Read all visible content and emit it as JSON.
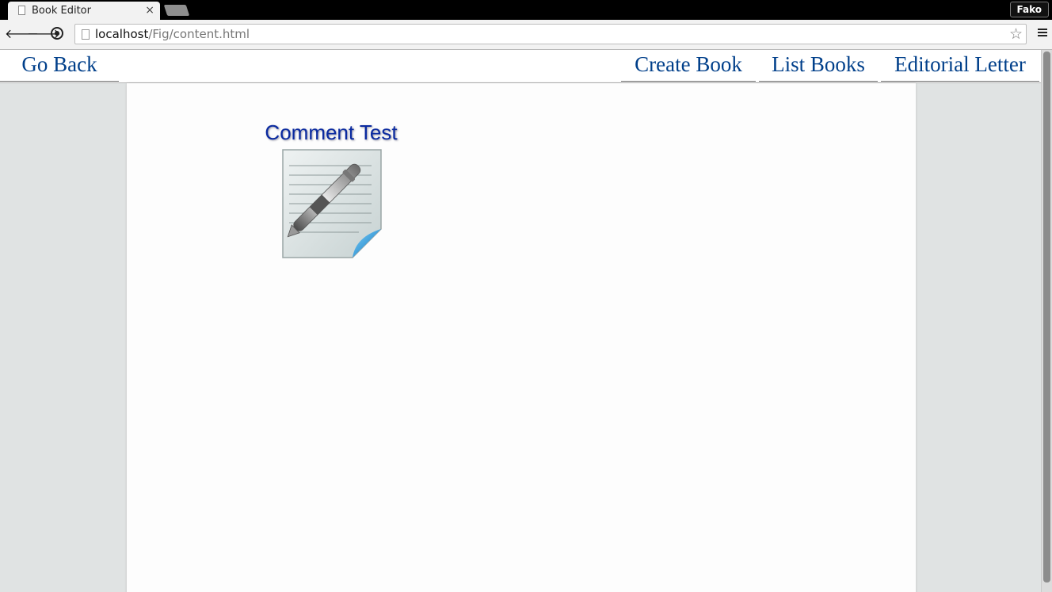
{
  "browser": {
    "tab_title": "Book Editor",
    "tab_close": "×",
    "profile_name": "Fako",
    "url_host": "localhost",
    "url_path": "/Fig/content.html",
    "back_glyph": "🡐",
    "forward_glyph": "🡒",
    "star_glyph": "☆",
    "icons": [
      "page-icon",
      "close-icon",
      "back-arrow-icon",
      "forward-arrow-icon",
      "globe-icon",
      "star-icon",
      "menu-icon"
    ]
  },
  "nav": {
    "go_back": "Go Back",
    "create_book": "Create Book",
    "list_books": "List Books",
    "editorial_letter": "Editorial Letter"
  },
  "books": [
    {
      "title": "Comment Test",
      "icon": "notepad-pen-icon"
    }
  ],
  "colors": {
    "link": "#003f8a",
    "book_title": "#0a2aa0",
    "page_background": "#e0e3e3",
    "content_background": "#fdfdfd"
  }
}
